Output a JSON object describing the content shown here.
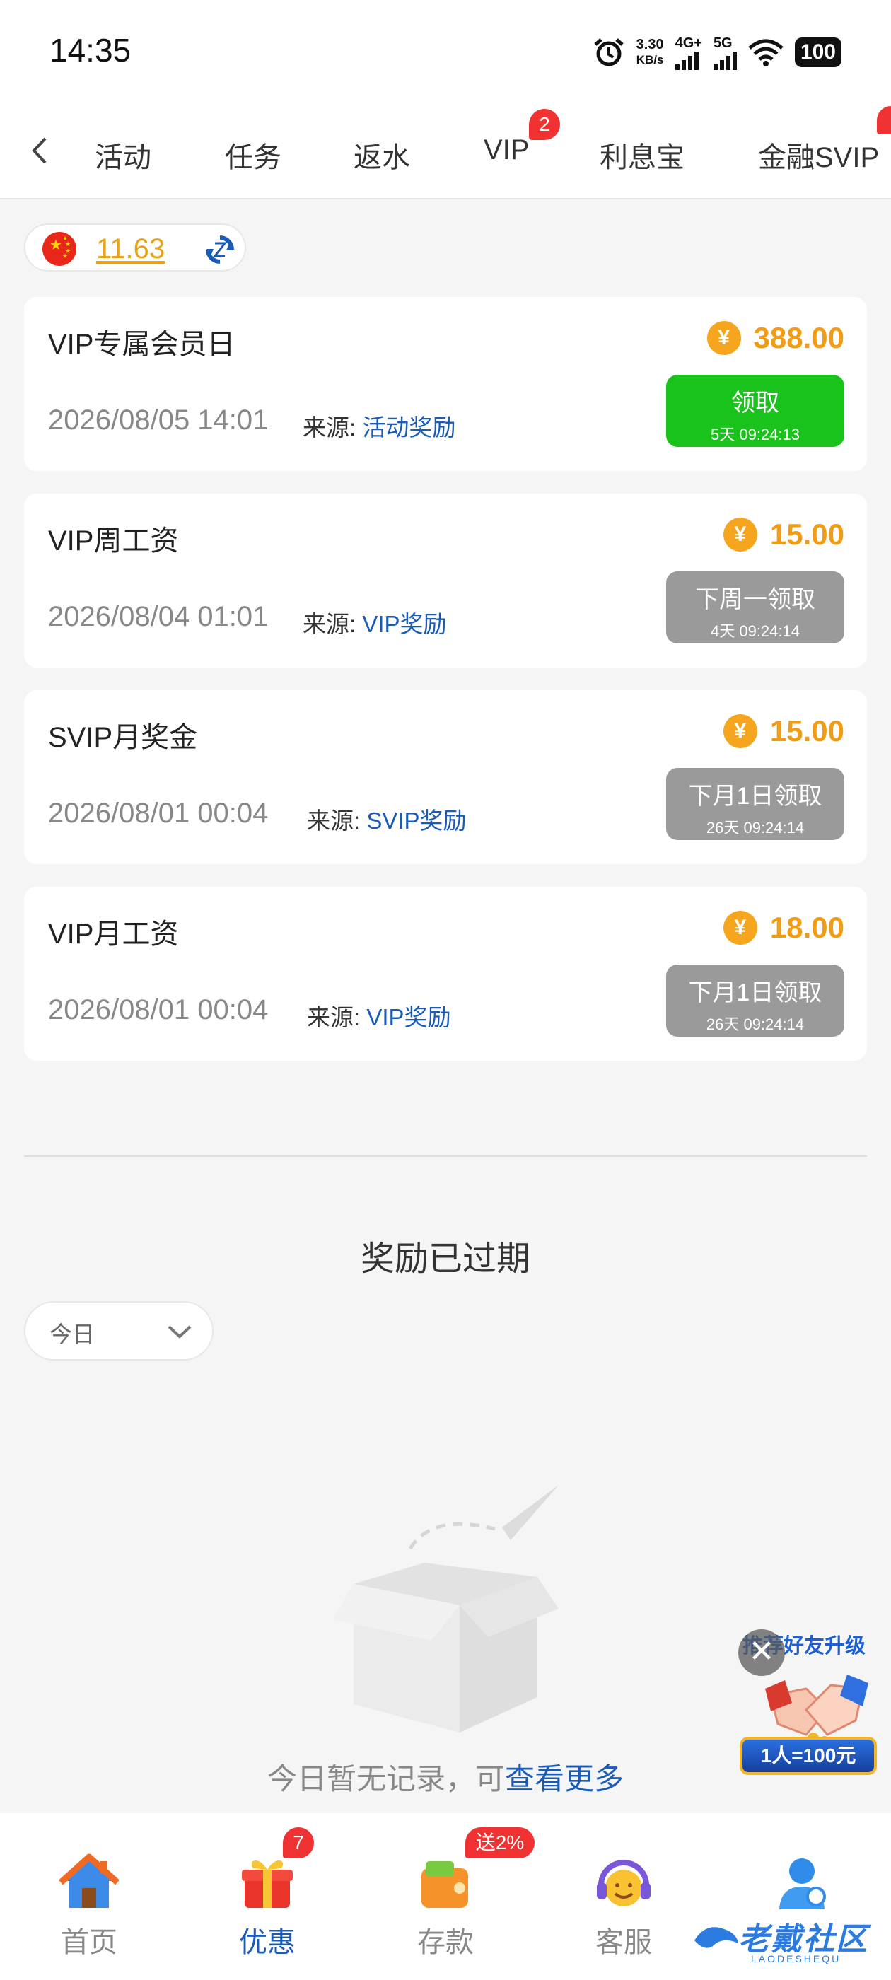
{
  "status_bar": {
    "time": "14:35",
    "net_speed_value": "3.30",
    "net_speed_unit": "KB/s",
    "signal_1": "4G+",
    "signal_2": "5G",
    "battery": "100",
    "icons": [
      "alarm-icon",
      "signal-icon",
      "wifi-icon",
      "battery-icon"
    ]
  },
  "tabs": [
    {
      "label": "活动"
    },
    {
      "label": "任务"
    },
    {
      "label": "返水"
    },
    {
      "label": "VIP",
      "badge": "2"
    },
    {
      "label": "利息宝"
    },
    {
      "label": "金融SVIP"
    }
  ],
  "balance": {
    "value": "11.63",
    "flag": "china-flag-icon",
    "refresh": "refresh-icon"
  },
  "rewards": [
    {
      "title": "VIP专属会员日",
      "amount": "388.00",
      "date": "2026/08/05 14:01",
      "source_label": "来源:",
      "source": "活动奖励",
      "button_label": "领取",
      "button_timer": "5天 09:24:13",
      "button_state": "active"
    },
    {
      "title": "VIP周工资",
      "amount": "15.00",
      "date": "2026/08/04 01:01",
      "source_label": "来源:",
      "source": "VIP奖励",
      "button_label": "下周一领取",
      "button_timer": "4天 09:24:14",
      "button_state": "disabled"
    },
    {
      "title": "SVIP月奖金",
      "amount": "15.00",
      "date": "2026/08/01 00:04",
      "source_label": "来源:",
      "source": "SVIP奖励",
      "button_label": "下月1日领取",
      "button_timer": "26天 09:24:14",
      "button_state": "disabled"
    },
    {
      "title": "VIP月工资",
      "amount": "18.00",
      "date": "2026/08/01 00:04",
      "source_label": "来源:",
      "source": "VIP奖励",
      "button_label": "下月1日领取",
      "button_timer": "26天 09:24:14",
      "button_state": "disabled"
    }
  ],
  "currency_symbol": "¥",
  "expired": {
    "title": "奖励已过期",
    "filter_value": "今日",
    "empty_text": "今日暂无记录，可",
    "empty_link": "查看更多"
  },
  "promo": {
    "text": "推荐好友升级",
    "banner": "1人=100元",
    "close": "✕"
  },
  "bottom_nav": [
    {
      "label": "首页",
      "icon": "home-icon"
    },
    {
      "label": "优惠",
      "icon": "gift-icon",
      "badge": "7",
      "active": true
    },
    {
      "label": "存款",
      "icon": "wallet-icon",
      "badge": "送2%"
    },
    {
      "label": "客服",
      "icon": "support-icon"
    },
    {
      "label": "",
      "icon": "profile-icon"
    }
  ],
  "watermark": {
    "text": "老戴社区",
    "sub": "LAODESHEQU"
  },
  "colors": {
    "accent_blue": "#1a5bb8",
    "amount_orange": "#f39c12",
    "claim_green": "#19c31c",
    "disabled_gray": "#9a9a9a",
    "badge_red": "#f03232"
  }
}
